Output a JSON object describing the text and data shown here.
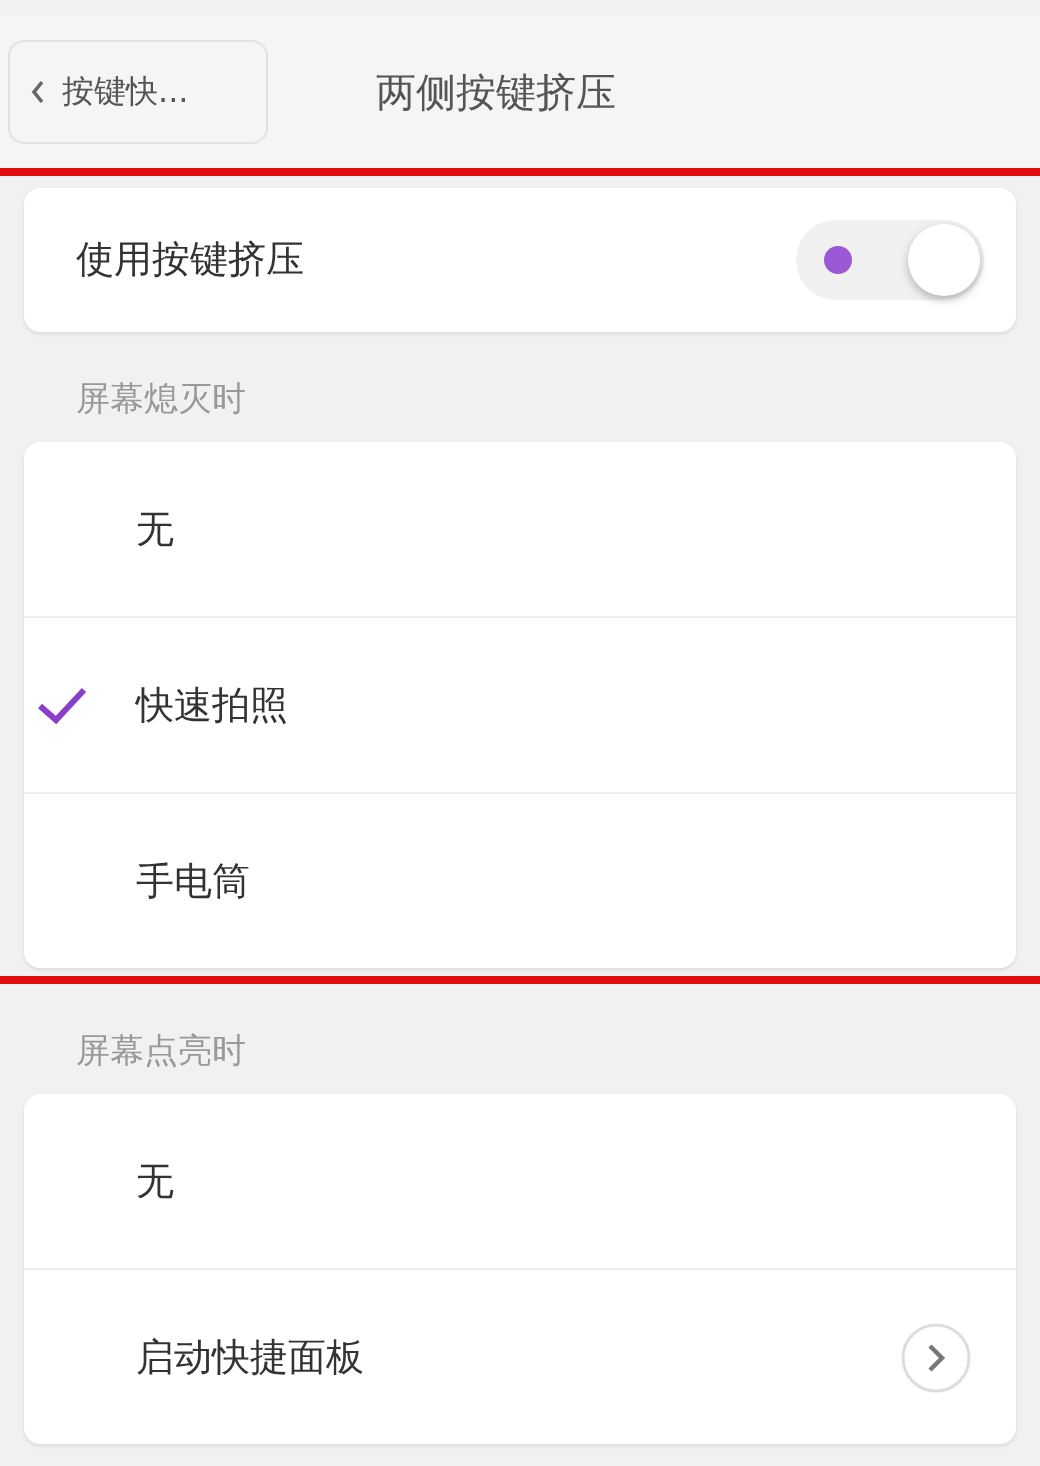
{
  "nav": {
    "back_label": "按键快...",
    "title": "两侧按键挤压"
  },
  "master": {
    "label": "使用按键挤压",
    "on": true
  },
  "sections": [
    {
      "header": "屏幕熄灭时",
      "highlighted": true,
      "items": [
        {
          "label": "无",
          "kind": "option",
          "selected": false
        },
        {
          "label": "快速拍照",
          "kind": "option",
          "selected": true
        },
        {
          "label": "手电筒",
          "kind": "option",
          "selected": false
        }
      ]
    },
    {
      "header": "屏幕点亮时",
      "highlighted": false,
      "items": [
        {
          "label": "无",
          "kind": "option",
          "selected": false
        },
        {
          "label": "启动快捷面板",
          "kind": "link"
        }
      ]
    }
  ]
}
